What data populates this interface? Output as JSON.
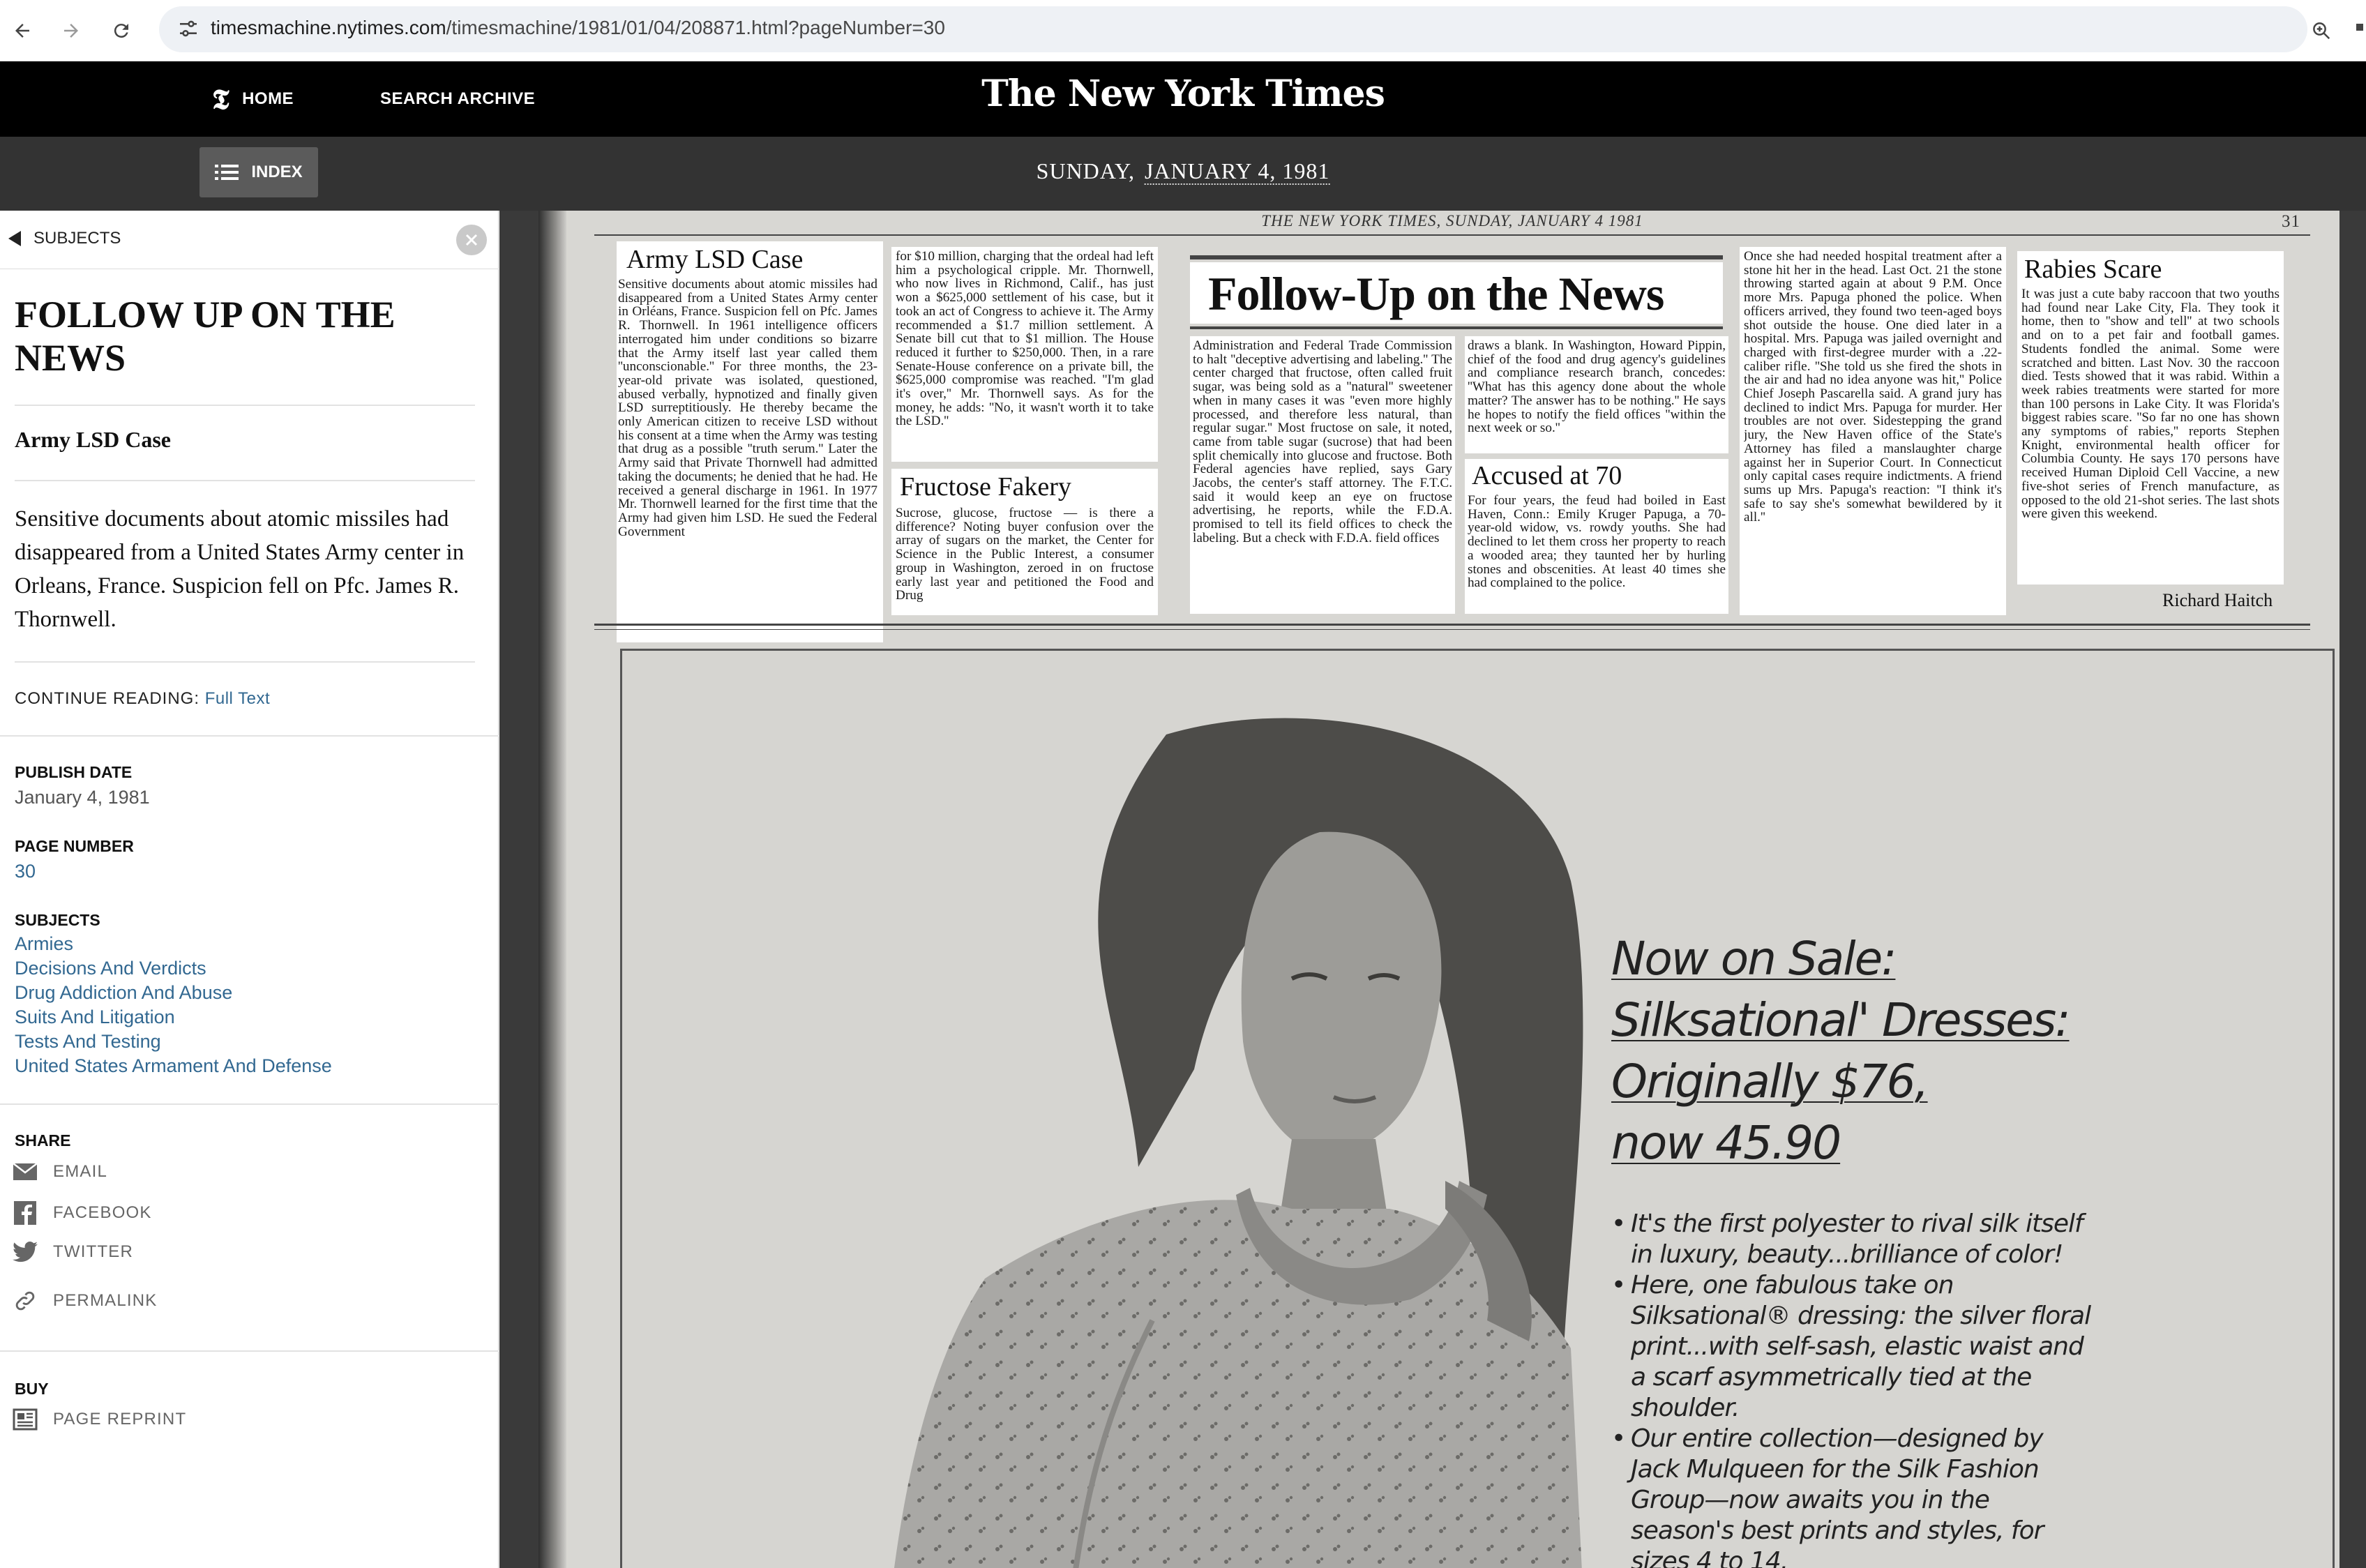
{
  "browser": {
    "url_host": "timesmachine.nytimes.com",
    "url_path": "/timesmachine/1981/01/04/208871.html?pageNumber=30"
  },
  "header": {
    "home_label": "HOME",
    "search_label": "SEARCH ARCHIVE",
    "logo": "The New York Times",
    "index_label": "INDEX",
    "day": "SUNDAY,",
    "date": "JANUARY 4, 1981"
  },
  "sidebar": {
    "back_label": "SUBJECTS",
    "title": "FOLLOW UP ON THE NEWS",
    "headline": "Army LSD Case",
    "lede": "Sensitive documents about atomic missiles had disappeared from a United States Army center in Orleans, France. Suspicion fell on Pfc. James R. Thornwell.",
    "continue_label": "CONTINUE READING:",
    "continue_link": "Full Text",
    "publish_date_label": "PUBLISH DATE",
    "publish_date": "January 4, 1981",
    "page_number_label": "PAGE NUMBER",
    "page_number": "30",
    "subjects_label": "SUBJECTS",
    "subjects": [
      "Armies",
      "Decisions And Verdicts",
      "Drug Addiction And Abuse",
      "Suits And Litigation",
      "Tests And Testing",
      "United States Armament And Defense"
    ],
    "share_label": "SHARE",
    "share": [
      "EMAIL",
      "FACEBOOK",
      "TWITTER",
      "PERMALINK"
    ],
    "buy_label": "BUY",
    "buy": [
      "PAGE REPRINT"
    ]
  },
  "page": {
    "folio": "THE NEW YORK TIMES, SUNDAY, JANUARY 4 1981",
    "page_no": "31",
    "section_title": "Follow-Up on the News",
    "hed_army": "Army LSD Case",
    "col_army": "Sensitive documents about atomic missiles had disappeared from a United States Army center in Orléans, France. Suspicion fell on Pfc. James R. Thornwell. In 1961 intelligence officers interrogated him under conditions so bizarre that the Army itself last year called them ''unconscionable.'' For three months, the 23-year-old private was isolated, questioned, abused verbally, hypnotized and finally given LSD surreptitiously. He thereby became the only American citizen to receive LSD without his consent at a time when the Army was testing that drug as a possible ''truth serum.'' Later the Army said that Private Thornwell had admitted taking the documents; he denied that he had. He received a general discharge in 1961. In 1977 Mr. Thornwell learned for the first time that the Army had given him LSD. He sued the Federal Government",
    "col_army2": "for $10 million, charging that the ordeal had left him a psychological cripple. Mr. Thornwell, who now lives in Richmond, Calif., has just won a $625,000 settlement of his case, but it took an act of Congress to achieve it. The Army recommended a $1.7 million settlement. A Senate bill cut that to $1 million. The House reduced it further to $250,000. Then, in a rare Senate-House conference on a private bill, the $625,000 compromise was reached. ''I'm glad it's over,'' Mr. Thornwell says. As for the money, he adds: ''No, it wasn't worth it to take the LSD.''",
    "hed_fructose": "Fructose Fakery",
    "col_fructose": "Sucrose, glucose, fructose — is there a difference? Noting buyer confusion over the array of sugars on the market, the Center for Science in the Public Interest, a consumer group in Washington, zeroed in on fructose early last year and petitioned the Food and Drug",
    "col_fructose2": "Administration and Federal Trade Commission to halt ''deceptive advertising and labeling.'' The center charged that fructose, often called fruit sugar, was being sold as a ''natural'' sweetener when in many cases it was ''even more highly processed, and therefore less natural, than regular sugar.'' Most fructose on sale, it noted, came from table sugar (sucrose) that had been split chemically into glucose and fructose. Both Federal agencies have replied, says Gary Jacobs, the center's staff attorney. The F.T.C. said it would keep an eye on fructose advertising, he reports, while the F.D.A. promised to tell its field offices to check the labeling. But a check with F.D.A. field offices",
    "col_fructose3": "draws a blank. In Washington, Howard Pippin, chief of the food and drug agency's guidelines and compliance research branch, concedes: ''What has this agency done about the whole matter? The answer has to be nothing.'' He says he hopes to notify the field offices ''within the next week or so.''",
    "hed_accused": "Accused at 70",
    "col_accused": "For four years, the feud had boiled in East Haven, Conn.: Emily Kruger Papuga, a 70-year-old widow, vs. rowdy youths. She had declined to let them cross her property to reach a wooded area; they taunted her by hurling stones and obscenities. At least 40 times she had complained to the police.",
    "col_accused2": "Once she had needed hospital treatment after a stone hit her in the head. Last Oct. 21 the stone throwing started again at about 9 P.M. Once more Mrs. Papuga phoned the police. When officers arrived, they found two teen-aged boys shot outside the house. One died later in a hospital. Mrs. Papuga was jailed overnight and charged with first-degree murder with a .22-caliber rifle. ''She told us she fired the shots in the air and had no idea anyone was hit,'' Police Chief Joseph Pascarella said. A grand jury has declined to indict Mrs. Papuga for murder. Her troubles are not over. Sidestepping the grand jury, the New Haven office of the State's Attorney has filed a manslaughter charge against her in Superior Court. In Connecticut only capital cases require indictments. A friend sums up Mrs. Papuga's reaction: ''I think it's safe to say she's somewhat bewildered by it all.''",
    "hed_rabies": "Rabies Scare",
    "col_rabies": "It was just a cute baby raccoon that two youths had found near Lake City, Fla. They took it home, then to ''show and tell'' at two schools and on to a pet fair and football games. Students fondled the animal. Some were scratched and bitten. Last Nov. 30 the raccoon died. Tests showed that it was rabid. Within a week rabies treatments were started for more than 100 persons in Lake City. It was Florida's biggest rabies scare. ''So far no one has shown any symptoms of rabies,'' reports Stephen Knight, environmental health officer for Columbia County. He says 170 persons have received Human Diploid Cell Vaccine, a new five-shot series of French manufacture, as opposed to the old 21-shot series. The last shots were given this weekend.",
    "byline": "Richard Haitch"
  },
  "ad": {
    "headline_lines": [
      "Now on Sale:",
      "Silksational' Dresses:",
      "Originally $76,",
      "now 45.90"
    ],
    "bullets": [
      "It's the first polyester to rival silk itself in luxury, beauty...brilliance of color!",
      "Here, one fabulous take on Silksational® dressing: the silver floral print...with self-sash, elastic waist and a scarf asymmetrically tied at the shoulder.",
      "Our entire collection—designed by Jack Mulqueen for the Silk Fashion Group—now awaits you in the season's best prints and styles, for sizes 4 to 14."
    ]
  }
}
